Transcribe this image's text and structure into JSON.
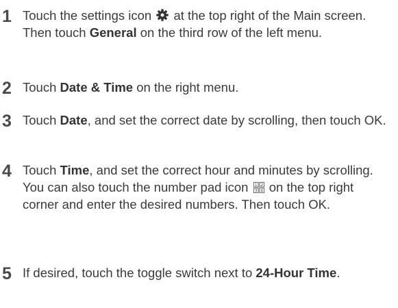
{
  "steps": [
    {
      "number": "1",
      "segments": {
        "a": "Touch the settings icon ",
        "b": " at the top right of the Main screen. Then touch ",
        "c": "General",
        "d": " on the third row of the left menu."
      },
      "icon": "gear-icon"
    },
    {
      "number": "2",
      "segments": {
        "a": "Touch ",
        "b": "Date & Time",
        "c": " on the right menu."
      }
    },
    {
      "number": "3",
      "segments": {
        "a": "Touch ",
        "b": "Date",
        "c": ", and set the correct date by scrolling, then touch OK."
      }
    },
    {
      "number": "4",
      "segments": {
        "a": "Touch ",
        "b": "Time",
        "c": ", and set the correct hour and minutes by scrolling. You can also touch the number pad icon ",
        "d": " on the top right corner and enter the desired numbers. Then touch OK."
      },
      "icon": "number-pad-icon",
      "icon_digits": [
        "1",
        "2",
        "3",
        "4"
      ]
    },
    {
      "number": "5",
      "segments": {
        "a": "If desired, touch the toggle switch next to ",
        "b": "24-Hour Time",
        "c": "."
      }
    }
  ],
  "colors": {
    "text": "#3a3a3a",
    "number": "#4a4a4a"
  }
}
